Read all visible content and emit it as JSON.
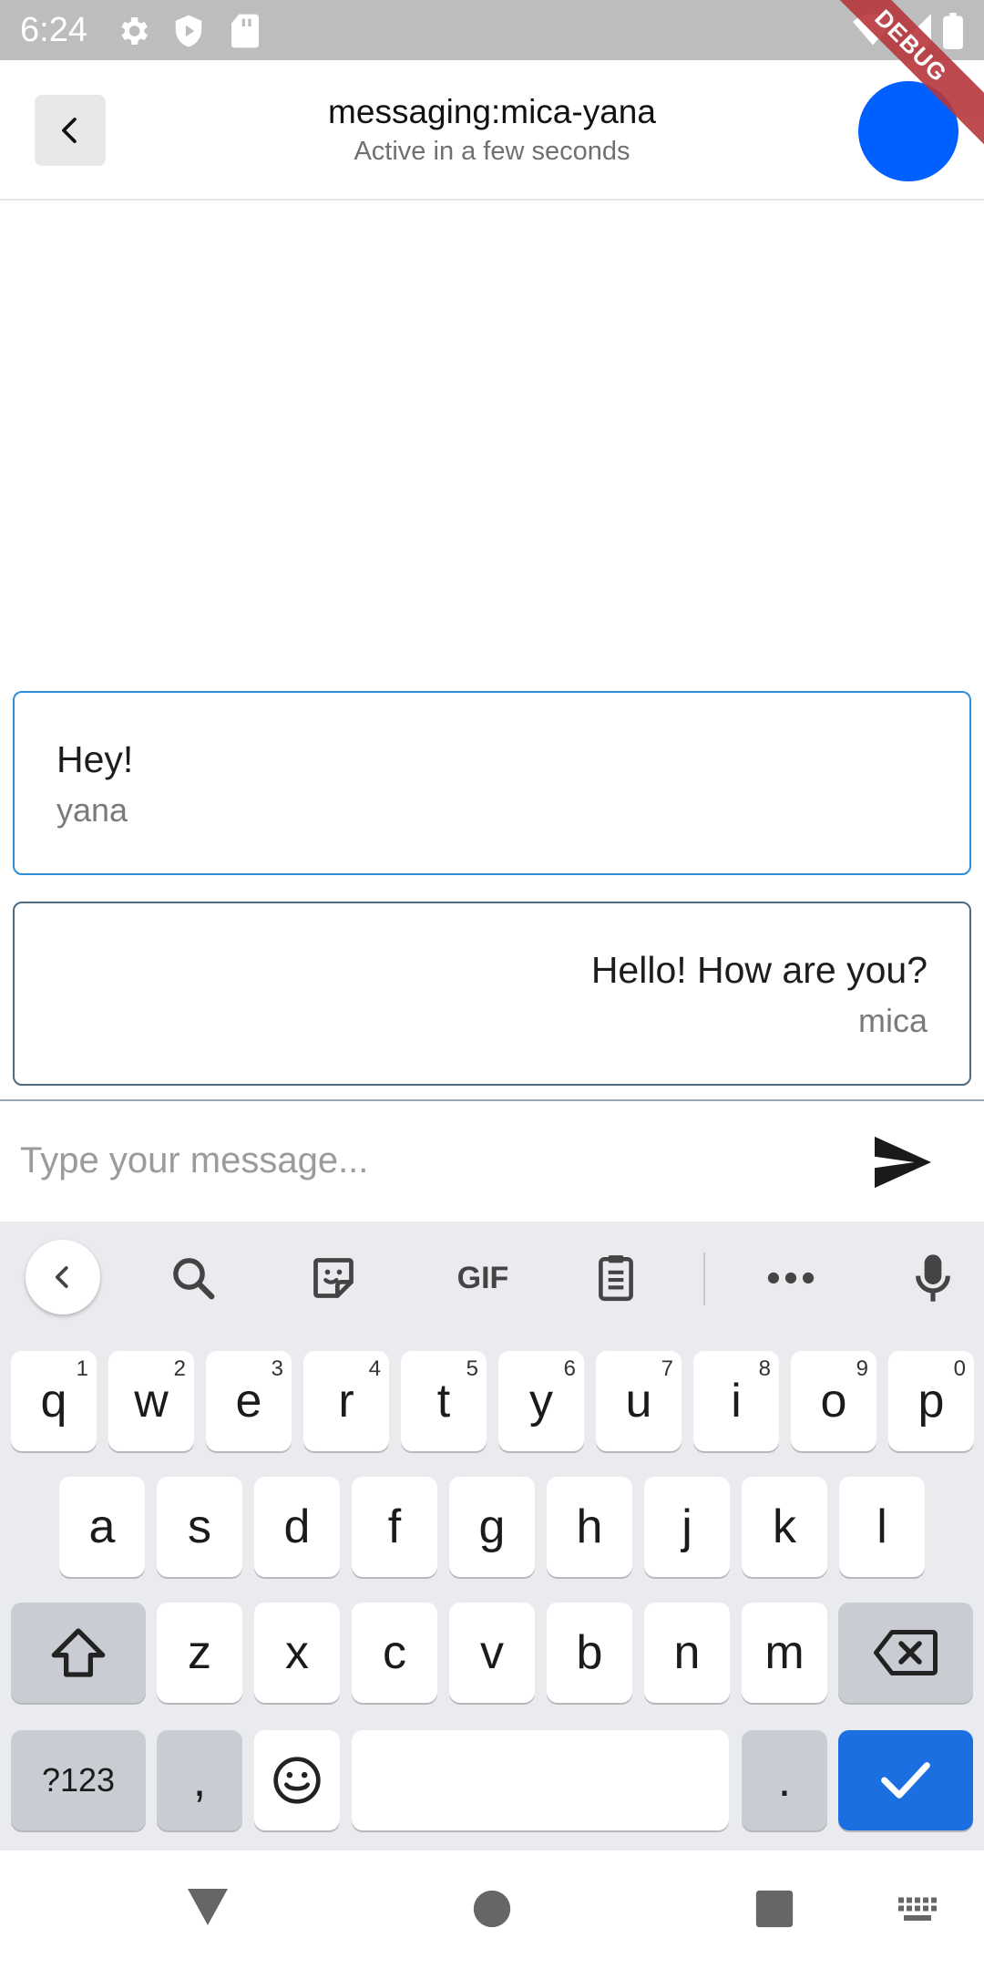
{
  "status_bar": {
    "time": "6:24",
    "debug_label": "DEBUG",
    "icons": [
      "gear-icon",
      "shield-play-icon",
      "sd-card-icon",
      "wifi-icon",
      "signal-icon",
      "battery-icon"
    ]
  },
  "header": {
    "title": "messaging:mica-yana",
    "subtitle": "Active in a few seconds",
    "avatar_color": "#005fff"
  },
  "messages": [
    {
      "text": "Hey!",
      "user": "yana",
      "align": "left",
      "border_color": "#2e8fd8"
    },
    {
      "text": "Hello! How are you?",
      "user": "mica",
      "align": "right",
      "border_color": "#4f6a80"
    }
  ],
  "composer": {
    "placeholder": "Type your message...",
    "value": ""
  },
  "keyboard": {
    "toolbar": {
      "gif_label": "GIF",
      "icons": [
        "chevron-left-icon",
        "search-icon",
        "sticker-icon",
        "gif-icon",
        "clipboard-icon",
        "more-icon",
        "microphone-icon"
      ]
    },
    "row1": [
      {
        "k": "q",
        "h": "1"
      },
      {
        "k": "w",
        "h": "2"
      },
      {
        "k": "e",
        "h": "3"
      },
      {
        "k": "r",
        "h": "4"
      },
      {
        "k": "t",
        "h": "5"
      },
      {
        "k": "y",
        "h": "6"
      },
      {
        "k": "u",
        "h": "7"
      },
      {
        "k": "i",
        "h": "8"
      },
      {
        "k": "o",
        "h": "9"
      },
      {
        "k": "p",
        "h": "0"
      }
    ],
    "row2": [
      "a",
      "s",
      "d",
      "f",
      "g",
      "h",
      "j",
      "k",
      "l"
    ],
    "row3": [
      "z",
      "x",
      "c",
      "v",
      "b",
      "n",
      "m"
    ],
    "row4": {
      "symbols": "?123",
      "comma": ",",
      "period": "."
    },
    "accent": "#1b6fe0"
  },
  "nav_bar": {
    "icons": [
      "back-triangle-icon",
      "home-circle-icon",
      "recents-square-icon",
      "keyboard-switch-icon"
    ]
  }
}
